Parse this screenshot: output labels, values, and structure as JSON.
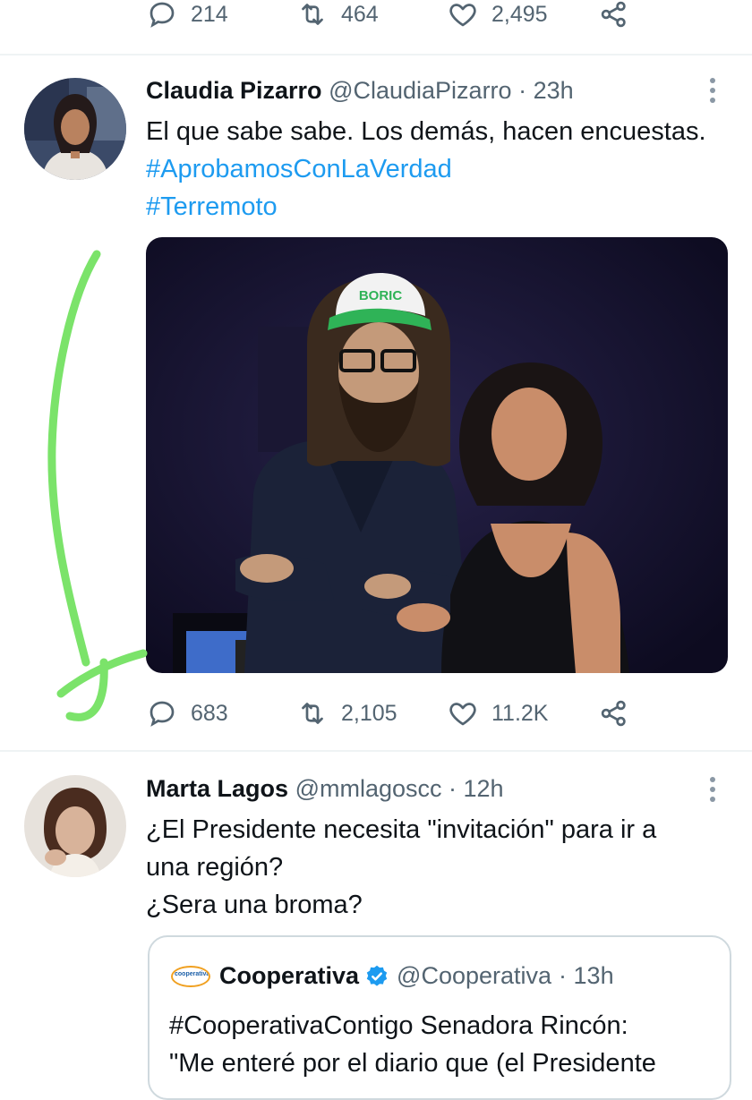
{
  "top_tweet_actions": {
    "replies": "214",
    "retweets": "464",
    "likes": "2,495"
  },
  "tweets": [
    {
      "display_name": "Claudia Pizarro",
      "handle": "@ClaudiaPizarro",
      "time": "· 23h",
      "text_plain": "El que sabe sabe. Los demás, hacen encuestas. ",
      "hashtag_1": "#AprobamosConLaVerdad",
      "hashtag_2": "#Terremoto",
      "replies": "683",
      "retweets": "2,105",
      "likes": "11.2K",
      "photo_cap_text": "BORIC"
    },
    {
      "display_name": "Marta Lagos",
      "handle": "@mmlagoscc",
      "time": "· 12h",
      "line_1": "¿El Presidente necesita \"invitación\" para ir a",
      "line_2": "una región?",
      "line_3": "¿Sera una broma?",
      "quote": {
        "logo_text": "cooperativa",
        "display_name": "Cooperativa",
        "handle": "@Cooperativa",
        "time": "· 13h",
        "line_1": "#CooperativaContigo Senadora Rincón:",
        "line_2": "\"Me enteré por el diario que (el Presidente"
      }
    }
  ],
  "colors": {
    "hashtag": "#1d9bf0",
    "secondary_text": "#536471",
    "annotation_arrow": "#7be36a",
    "verified_badge": "#1d9bf0"
  },
  "icons": [
    "reply-icon",
    "retweet-icon",
    "like-icon",
    "share-icon",
    "more-icon",
    "verified-icon"
  ]
}
